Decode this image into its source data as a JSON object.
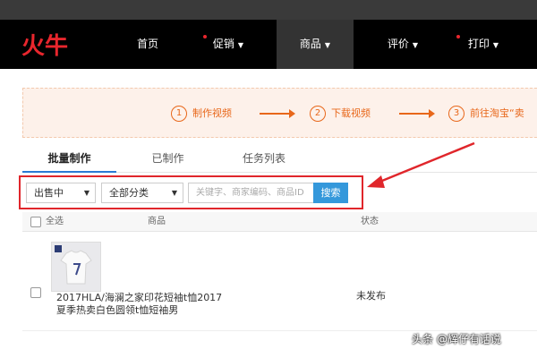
{
  "brand": {
    "logo_text": "火牛",
    "logo_color": "#e8262d"
  },
  "nav": {
    "items": [
      {
        "label": "首页",
        "has_dot": false,
        "has_caret": false
      },
      {
        "label": "促销",
        "has_dot": true,
        "has_caret": true
      },
      {
        "label": "商品",
        "has_dot": false,
        "has_caret": true,
        "active": true
      },
      {
        "label": "评价",
        "has_dot": false,
        "has_caret": true
      },
      {
        "label": "打印",
        "has_dot": true,
        "has_caret": true
      }
    ]
  },
  "steps": [
    {
      "num": "1",
      "label": "制作视频"
    },
    {
      "num": "2",
      "label": "下载视频"
    },
    {
      "num": "3",
      "label": "前往淘宝“卖"
    }
  ],
  "tabs": [
    {
      "label": "批量制作",
      "active": true
    },
    {
      "label": "已制作"
    },
    {
      "label": "任务列表"
    }
  ],
  "filters": {
    "status_select": "出售中",
    "category_select": "全部分类",
    "search_placeholder": "关键字、商家编码、商品ID",
    "search_button": "搜索"
  },
  "table": {
    "headers": {
      "select_all": "全选",
      "product": "商品",
      "status": "状态"
    },
    "rows": [
      {
        "name": "2017HLA/海澜之家印花短袖t恤2017夏季热卖白色圆领t恤短袖男",
        "status": "未发布"
      }
    ]
  },
  "watermark": "头条 @辉仔有话说",
  "colors": {
    "accent": "#e8671a",
    "highlight": "#e0262b",
    "button": "#3498db",
    "tab_underline": "#2a7ad4"
  }
}
